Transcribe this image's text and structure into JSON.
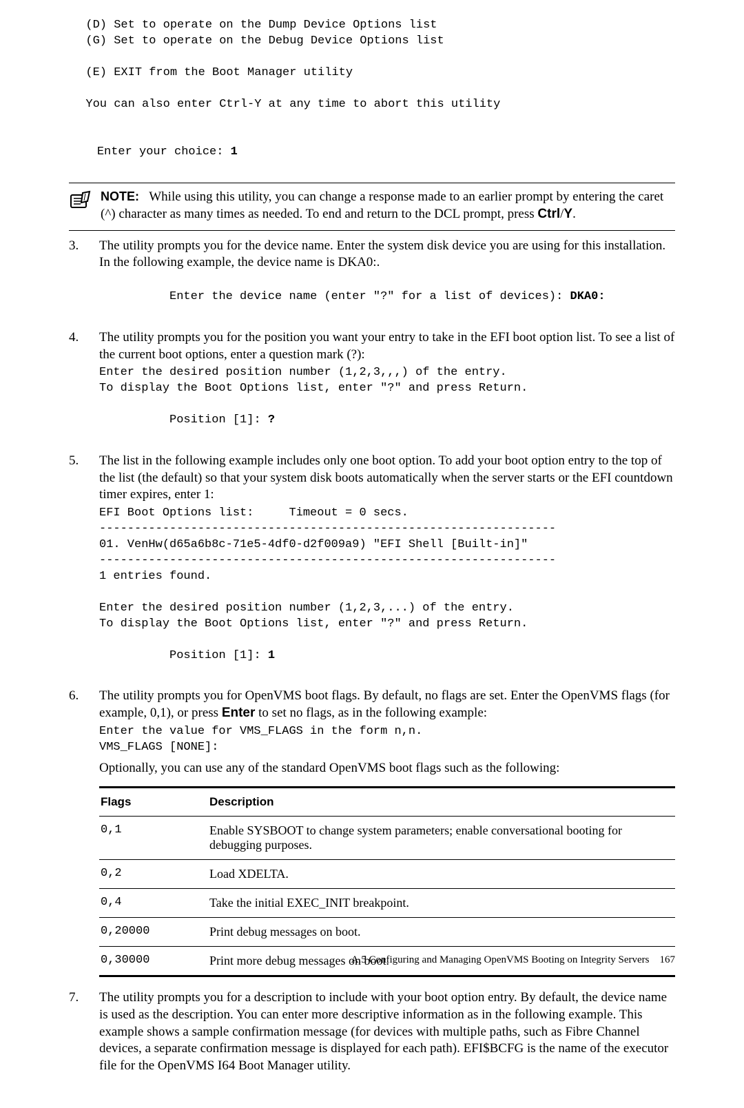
{
  "top_code": {
    "l1": "  (D) Set to operate on the Dump Device Options list",
    "l2": "  (G) Set to operate on the Debug Device Options list",
    "l3": "  (E) EXIT from the Boot Manager utility",
    "l4": "  You can also enter Ctrl-Y at any time to abort this utility",
    "l5": "Enter your choice: ",
    "l5b": "1"
  },
  "note": {
    "label": "NOTE:",
    "text_a": "While using this utility, you can change a response made to an earlier prompt by entering the caret (^) character as many times as needed. To end and return to the DCL prompt, press ",
    "key1": "Ctrl",
    "sep": "/",
    "key2": "Y",
    "dot": "."
  },
  "step3": {
    "num": "3.",
    "p": "The utility prompts you for the device name. Enter the system disk device you are using for this installation. In the following example, the device name is DKA0:.",
    "code_a": "Enter the device name (enter \"?\" for a list of devices): ",
    "code_b": "DKA0:"
  },
  "step4": {
    "num": "4.",
    "p": "The utility prompts you for the position you want your entry to take in the EFI boot option list. To see a list of the current boot options, enter a question mark (?):",
    "c1": "Enter the desired position number (1,2,3,,,) of the entry.",
    "c2": "To display the Boot Options list, enter \"?\" and press Return.",
    "c3": "Position [1]: ",
    "c3b": "?"
  },
  "step5": {
    "num": "5.",
    "p": "The list in the following example includes only one boot option. To add your boot option entry to the top of the list (the default) so that your system disk boots automatically when the server starts or the EFI countdown timer expires, enter 1:",
    "c1": "EFI Boot Options list:     Timeout = 0 secs.",
    "c2": "-----------------------------------------------------------------",
    "c3": "01. VenHw(d65a6b8c-71e5-4df0-d2f009a9) \"EFI Shell [Built-in]\"",
    "c4": "-----------------------------------------------------------------",
    "c5": "1 entries found.",
    "c6": "Enter the desired position number (1,2,3,...) of the entry.",
    "c7": "To display the Boot Options list, enter \"?\" and press Return.",
    "c8": "Position [1]: ",
    "c8b": "1"
  },
  "step6": {
    "num": "6.",
    "p_a": "The utility prompts you for OpenVMS boot flags. By default, no flags are set. Enter the OpenVMS flags (for example, 0,1), or press ",
    "enter": "Enter",
    "p_b": " to set no flags, as in the following example:",
    "c1": "Enter the value for VMS_FLAGS in the form n,n.",
    "c2": "VMS_FLAGS [NONE]:",
    "p_c": "Optionally, you can use any of the standard OpenVMS boot flags such as the following:"
  },
  "flags_table": {
    "h1": "Flags",
    "h2": "Description",
    "rows": [
      {
        "f": "0,1",
        "d": "Enable SYSBOOT to change system parameters; enable conversational booting for debugging purposes."
      },
      {
        "f": "0,2",
        "d": "Load XDELTA."
      },
      {
        "f": "0,4",
        "d": "Take the initial EXEC_INIT breakpoint."
      },
      {
        "f": "0,20000",
        "d": "Print debug messages on boot."
      },
      {
        "f": "0,30000",
        "d": "Print more debug messages on boot."
      }
    ]
  },
  "step7": {
    "num": "7.",
    "p": "The utility prompts you for a description to include with your boot option entry. By default, the device name is used as the description. You can enter more descriptive information as in the following example. This example shows a sample confirmation message (for devices with multiple paths, such as Fibre Channel devices, a separate confirmation message is displayed for each path). EFI$BCFG is the name of the executor file for the OpenVMS I64 Boot Manager utility."
  },
  "footer": {
    "text": "A.5 Configuring and Managing OpenVMS Booting on Integrity Servers",
    "page": "167"
  }
}
